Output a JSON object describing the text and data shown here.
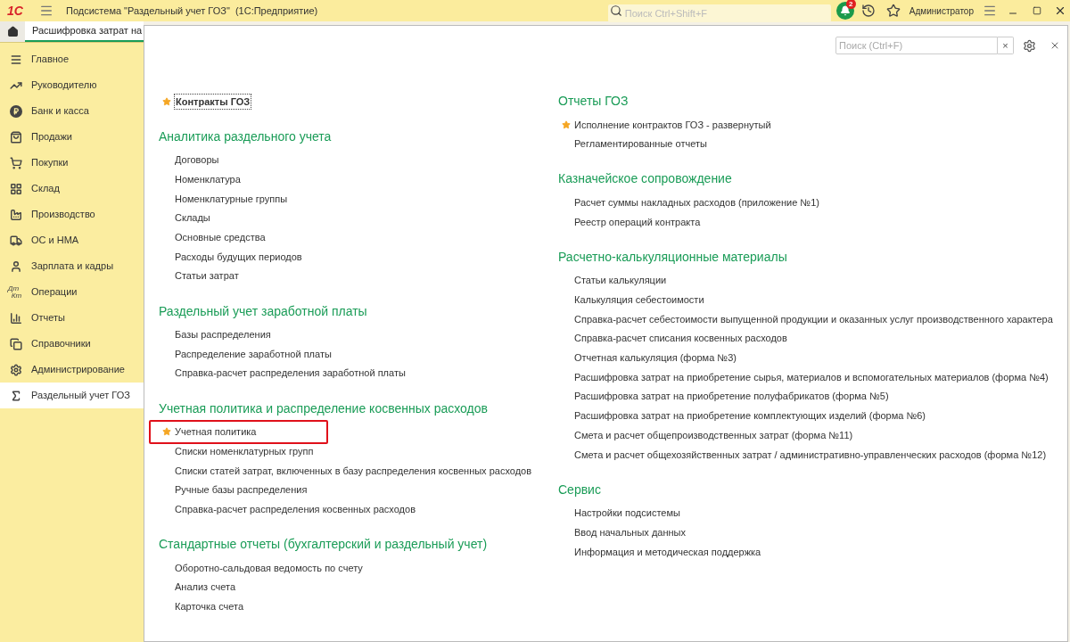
{
  "title_bar": {
    "logo": "1С",
    "title": "Подсистема \"Раздельный учет ГОЗ\"  (1С:Предприятие)",
    "search": {
      "placeholder": "Поиск Ctrl+Shift+F"
    },
    "notifications": "2",
    "user": "Администратор"
  },
  "open_tab": {
    "label": "Расшифровка затрат на",
    "selected": true
  },
  "sidebar": {
    "items": [
      {
        "label": "Главное",
        "selected": false
      },
      {
        "label": "Руководителю",
        "selected": false
      },
      {
        "label": "Банк и касса",
        "selected": false
      },
      {
        "label": "Продажи",
        "selected": false
      },
      {
        "label": "Покупки",
        "selected": false
      },
      {
        "label": "Склад",
        "selected": false
      },
      {
        "label": "Производство",
        "selected": false
      },
      {
        "label": "ОС и НМА",
        "selected": false
      },
      {
        "label": "Зарплата и кадры",
        "selected": false
      },
      {
        "label": "Операции",
        "selected": false,
        "icon_text": [
          "Дт",
          "Кт"
        ]
      },
      {
        "label": "Отчеты",
        "selected": false
      },
      {
        "label": "Справочники",
        "selected": false
      },
      {
        "label": "Администрирование",
        "selected": false
      },
      {
        "label": "Раздельный учет ГОЗ",
        "selected": true
      }
    ]
  },
  "panel": {
    "search": {
      "placeholder": "Поиск (Ctrl+F)"
    },
    "clear": "×",
    "columns": [
      [
        {
          "items": [
            {
              "label": "Контракты ГОЗ",
              "favorite": true,
              "focused": true,
              "highlighted": false
            }
          ]
        },
        {
          "heading": "Аналитика раздельного учета",
          "items": [
            {
              "label": "Договоры",
              "favorite": false,
              "focused": false,
              "highlighted": false
            },
            {
              "label": "Номенклатура",
              "favorite": false,
              "focused": false,
              "highlighted": false
            },
            {
              "label": "Номенклатурные группы",
              "favorite": false,
              "focused": false,
              "highlighted": false
            },
            {
              "label": "Склады",
              "favorite": false,
              "focused": false,
              "highlighted": false
            },
            {
              "label": "Основные средства",
              "favorite": false,
              "focused": false,
              "highlighted": false
            },
            {
              "label": "Расходы будущих периодов",
              "favorite": false,
              "focused": false,
              "highlighted": false
            },
            {
              "label": "Статьи затрат",
              "favorite": false,
              "focused": false,
              "highlighted": false
            }
          ]
        },
        {
          "heading": "Раздельный учет заработной платы",
          "items": [
            {
              "label": "Базы распределения",
              "favorite": false,
              "focused": false,
              "highlighted": false
            },
            {
              "label": "Распределение заработной платы",
              "favorite": false,
              "focused": false,
              "highlighted": false
            },
            {
              "label": "Справка-расчет распределения заработной платы",
              "favorite": false,
              "focused": false,
              "highlighted": false
            }
          ]
        },
        {
          "heading": "Учетная политика и распределение косвенных расходов",
          "items": [
            {
              "label": "Учетная политика",
              "favorite": true,
              "focused": false,
              "highlighted": true
            },
            {
              "label": "Списки номенклатурных групп",
              "favorite": false,
              "focused": false,
              "highlighted": false
            },
            {
              "label": "Списки статей затрат, включенных в базу распределения косвенных расходов",
              "favorite": false,
              "focused": false,
              "highlighted": false
            },
            {
              "label": "Ручные базы распределения",
              "favorite": false,
              "focused": false,
              "highlighted": false
            },
            {
              "label": "Справка-расчет распределения косвенных расходов",
              "favorite": false,
              "focused": false,
              "highlighted": false
            }
          ]
        },
        {
          "heading": "Стандартные отчеты (бухгалтерский и раздельный учет)",
          "items": [
            {
              "label": "Оборотно-сальдовая ведомость по счету",
              "favorite": false,
              "focused": false,
              "highlighted": false
            },
            {
              "label": "Анализ счета",
              "favorite": false,
              "focused": false,
              "highlighted": false
            },
            {
              "label": "Карточка счета",
              "favorite": false,
              "focused": false,
              "highlighted": false
            }
          ]
        }
      ],
      [
        {
          "heading": "Отчеты ГОЗ",
          "items": [
            {
              "label": "Исполнение контрактов ГОЗ - развернутый",
              "favorite": true,
              "focused": false,
              "highlighted": false
            },
            {
              "label": "Регламентированные отчеты",
              "favorite": false,
              "focused": false,
              "highlighted": false
            }
          ]
        },
        {
          "heading": "Казначейское сопровождение",
          "items": [
            {
              "label": "Расчет суммы накладных расходов (приложение №1)",
              "favorite": false,
              "focused": false,
              "highlighted": false
            },
            {
              "label": "Реестр операций контракта",
              "favorite": false,
              "focused": false,
              "highlighted": false
            }
          ]
        },
        {
          "heading": "Расчетно-калькуляционные материалы",
          "items": [
            {
              "label": "Статьи калькуляции",
              "favorite": false,
              "focused": false,
              "highlighted": false
            },
            {
              "label": "Калькуляция себестоимости",
              "favorite": false,
              "focused": false,
              "highlighted": false
            },
            {
              "label": "Справка-расчет себестоимости выпущенной продукции и оказанных услуг производственного характера",
              "favorite": false,
              "focused": false,
              "highlighted": false
            },
            {
              "label": "Справка-расчет списания косвенных расходов",
              "favorite": false,
              "focused": false,
              "highlighted": false
            },
            {
              "label": "Отчетная калькуляция (форма №3)",
              "favorite": false,
              "focused": false,
              "highlighted": false
            },
            {
              "label": "Расшифровка затрат на приобретение сырья, материалов и вспомогательных материалов (форма №4)",
              "favorite": false,
              "focused": false,
              "highlighted": false
            },
            {
              "label": "Расшифровка затрат на приобретение полуфабрикатов (форма №5)",
              "favorite": false,
              "focused": false,
              "highlighted": false
            },
            {
              "label": "Расшифровка затрат на приобретение комплектующих изделий (форма №6)",
              "favorite": false,
              "focused": false,
              "highlighted": false
            },
            {
              "label": "Смета и расчет общепроизводственных затрат (форма №11)",
              "favorite": false,
              "focused": false,
              "highlighted": false
            },
            {
              "label": "Смета и расчет общехозяйственных затрат / административно-управленческих расходов (форма №12)",
              "favorite": false,
              "focused": false,
              "highlighted": false
            }
          ]
        },
        {
          "heading": "Сервис",
          "items": [
            {
              "label": "Настройки подсистемы",
              "favorite": false,
              "focused": false,
              "highlighted": false
            },
            {
              "label": "Ввод начальных данных",
              "favorite": false,
              "focused": false,
              "highlighted": false
            },
            {
              "label": "Информация и методическая поддержка",
              "favorite": false,
              "focused": false,
              "highlighted": false
            }
          ]
        }
      ]
    ]
  }
}
